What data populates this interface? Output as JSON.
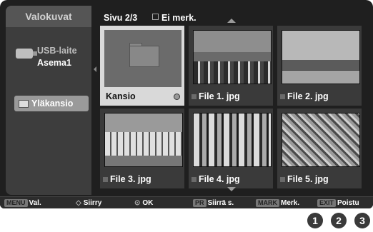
{
  "sidebar": {
    "app_title": "Valokuvat",
    "device_label": "USB-laite",
    "drive_label": "Asema1",
    "parent_folder_label": "Yläkansio"
  },
  "header": {
    "page_label": "Sivu 2/3",
    "unmarked_label": "Ei merk."
  },
  "grid": {
    "items": [
      {
        "label": "Kansio",
        "type": "folder",
        "selected": true
      },
      {
        "label": "File 1. jpg",
        "type": "image"
      },
      {
        "label": "File 2. jpg",
        "type": "image"
      },
      {
        "label": "File 3. jpg",
        "type": "image"
      },
      {
        "label": "File 4. jpg",
        "type": "image"
      },
      {
        "label": "File 5. jpg",
        "type": "image"
      }
    ]
  },
  "bottom_bar": {
    "menu_key": "MENU",
    "menu_label": "Val.",
    "move_label": "Siirry",
    "ok_label": "OK",
    "pr_key": "PR",
    "page_move_label": "Siirrä s.",
    "mark_key": "MARK",
    "mark_label": "Merk.",
    "exit_key": "EXIT",
    "exit_label": "Poistu"
  },
  "badges": [
    "1",
    "2",
    "3"
  ]
}
